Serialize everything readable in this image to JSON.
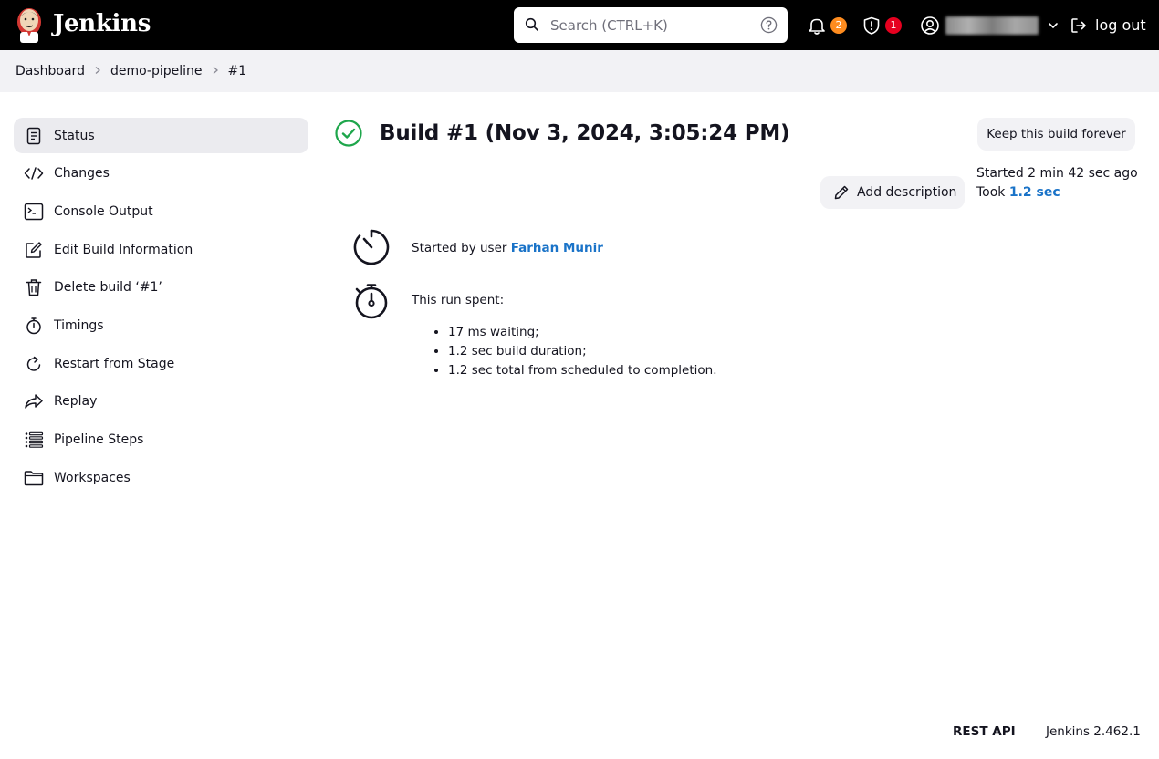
{
  "header": {
    "brand": "Jenkins",
    "search_placeholder": "Search (CTRL+K)",
    "notifications_count": "2",
    "security_count": "1",
    "logout_label": "log out",
    "colors": {
      "background": "#000000",
      "badge_orange": "#fe8c1f",
      "badge_red": "#e6001f"
    }
  },
  "breadcrumb": [
    "Dashboard",
    "demo-pipeline",
    "#1"
  ],
  "sidebar": {
    "items": [
      {
        "label": "Status",
        "icon": "document-icon",
        "active": true
      },
      {
        "label": "Changes",
        "icon": "code-icon"
      },
      {
        "label": "Console Output",
        "icon": "terminal-icon"
      },
      {
        "label": "Edit Build Information",
        "icon": "edit-icon"
      },
      {
        "label": "Delete build ‘#1’",
        "icon": "trash-icon"
      },
      {
        "label": "Timings",
        "icon": "stopwatch-icon"
      },
      {
        "label": "Restart from Stage",
        "icon": "restart-icon"
      },
      {
        "label": "Replay",
        "icon": "replay-icon"
      },
      {
        "label": "Pipeline Steps",
        "icon": "list-icon"
      },
      {
        "label": "Workspaces",
        "icon": "folder-icon"
      }
    ]
  },
  "main": {
    "title": "Build #1 (Nov 3, 2024, 3:05:24 PM)",
    "status_color": "#1ea64b",
    "keep_forever_label": "Keep this build forever",
    "started_ago": "Started 2 min 42 sec ago",
    "took_prefix": "Took ",
    "took_value": "1.2 sec",
    "add_description_label": "Add description",
    "started_by_prefix": "Started by user ",
    "started_by_user": "Farhan Munir",
    "run_spent_label": "This run spent:",
    "run_spent_items": [
      "17 ms waiting;",
      "1.2 sec build duration;",
      "1.2 sec total from scheduled to completion."
    ],
    "link_color": "#1a73c8"
  },
  "footer": {
    "rest_api": "REST API",
    "version": "Jenkins 2.462.1"
  }
}
